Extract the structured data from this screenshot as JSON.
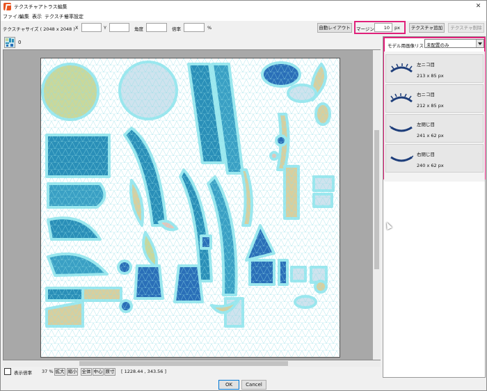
{
  "window": {
    "title": "テクスチャアトラス編集",
    "close_glyph": "✕"
  },
  "menu": [
    "ファイル",
    "編集",
    "表示",
    "テクスチャ",
    "倍率設定"
  ],
  "toolbar": {
    "size_label": "テクスチャサイズ ( 2048 x 2048 )",
    "x_label": "X",
    "x_value": "",
    "y_label": "Y",
    "y_value": "",
    "angle_label": "角度",
    "angle_value": "",
    "scale_label": "倍率",
    "scale_value": "",
    "percent_label": "%",
    "auto_layout_label": "自動レイアウト",
    "margin_label": "マージン",
    "margin_value": "10",
    "margin_unit": "px",
    "add_texture_label": "テクスチャ追加",
    "delete_texture_label": "テクスチャ削除"
  },
  "texture_tabs": [
    {
      "label": "0"
    }
  ],
  "status": {
    "display_scale_label": "表示倍率",
    "scale_value": "37 %",
    "zoom_in": "拡大",
    "zoom_out": "縮小",
    "fit_all": "全体",
    "center": "中心",
    "actual": "原寸",
    "coords": "[ 1228.44 , 343.56 ]"
  },
  "right_panel": {
    "label": "モデル用画像リスト",
    "filter_value": "未配置のみ",
    "items": [
      {
        "name": "左ニコ目",
        "size": "213 x 85 px",
        "icon": "smiling-eye-left-icon"
      },
      {
        "name": "右ニコ目",
        "size": "212 x 85 px",
        "icon": "smiling-eye-right-icon"
      },
      {
        "name": "左閉じ目",
        "size": "241 x 62 px",
        "icon": "closed-eye-left-icon"
      },
      {
        "name": "右閉じ目",
        "size": "240 x 62 px",
        "icon": "closed-eye-right-icon"
      }
    ]
  },
  "footer": {
    "ok_label": "OK",
    "cancel_label": "Cancel"
  },
  "colors": {
    "highlight": "#e0207a",
    "texture_part_fill": "#2a8fb8",
    "texture_part_outline": "#9be8ef"
  }
}
